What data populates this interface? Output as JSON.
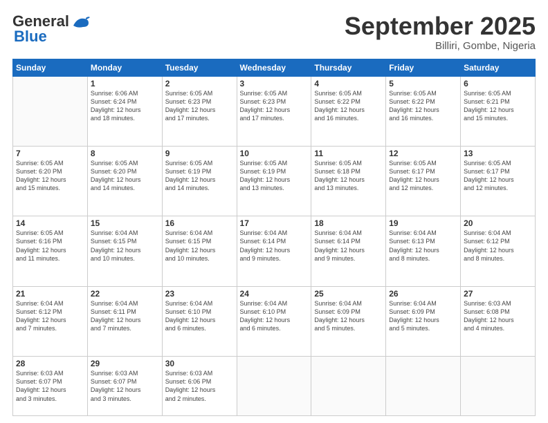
{
  "header": {
    "logo_line1": "General",
    "logo_line2": "Blue",
    "month": "September 2025",
    "location": "Billiri, Gombe, Nigeria"
  },
  "weekdays": [
    "Sunday",
    "Monday",
    "Tuesday",
    "Wednesday",
    "Thursday",
    "Friday",
    "Saturday"
  ],
  "weeks": [
    [
      {
        "day": "",
        "info": ""
      },
      {
        "day": "1",
        "info": "Sunrise: 6:06 AM\nSunset: 6:24 PM\nDaylight: 12 hours\nand 18 minutes."
      },
      {
        "day": "2",
        "info": "Sunrise: 6:05 AM\nSunset: 6:23 PM\nDaylight: 12 hours\nand 17 minutes."
      },
      {
        "day": "3",
        "info": "Sunrise: 6:05 AM\nSunset: 6:23 PM\nDaylight: 12 hours\nand 17 minutes."
      },
      {
        "day": "4",
        "info": "Sunrise: 6:05 AM\nSunset: 6:22 PM\nDaylight: 12 hours\nand 16 minutes."
      },
      {
        "day": "5",
        "info": "Sunrise: 6:05 AM\nSunset: 6:22 PM\nDaylight: 12 hours\nand 16 minutes."
      },
      {
        "day": "6",
        "info": "Sunrise: 6:05 AM\nSunset: 6:21 PM\nDaylight: 12 hours\nand 15 minutes."
      }
    ],
    [
      {
        "day": "7",
        "info": "Sunrise: 6:05 AM\nSunset: 6:20 PM\nDaylight: 12 hours\nand 15 minutes."
      },
      {
        "day": "8",
        "info": "Sunrise: 6:05 AM\nSunset: 6:20 PM\nDaylight: 12 hours\nand 14 minutes."
      },
      {
        "day": "9",
        "info": "Sunrise: 6:05 AM\nSunset: 6:19 PM\nDaylight: 12 hours\nand 14 minutes."
      },
      {
        "day": "10",
        "info": "Sunrise: 6:05 AM\nSunset: 6:19 PM\nDaylight: 12 hours\nand 13 minutes."
      },
      {
        "day": "11",
        "info": "Sunrise: 6:05 AM\nSunset: 6:18 PM\nDaylight: 12 hours\nand 13 minutes."
      },
      {
        "day": "12",
        "info": "Sunrise: 6:05 AM\nSunset: 6:17 PM\nDaylight: 12 hours\nand 12 minutes."
      },
      {
        "day": "13",
        "info": "Sunrise: 6:05 AM\nSunset: 6:17 PM\nDaylight: 12 hours\nand 12 minutes."
      }
    ],
    [
      {
        "day": "14",
        "info": "Sunrise: 6:05 AM\nSunset: 6:16 PM\nDaylight: 12 hours\nand 11 minutes."
      },
      {
        "day": "15",
        "info": "Sunrise: 6:04 AM\nSunset: 6:15 PM\nDaylight: 12 hours\nand 10 minutes."
      },
      {
        "day": "16",
        "info": "Sunrise: 6:04 AM\nSunset: 6:15 PM\nDaylight: 12 hours\nand 10 minutes."
      },
      {
        "day": "17",
        "info": "Sunrise: 6:04 AM\nSunset: 6:14 PM\nDaylight: 12 hours\nand 9 minutes."
      },
      {
        "day": "18",
        "info": "Sunrise: 6:04 AM\nSunset: 6:14 PM\nDaylight: 12 hours\nand 9 minutes."
      },
      {
        "day": "19",
        "info": "Sunrise: 6:04 AM\nSunset: 6:13 PM\nDaylight: 12 hours\nand 8 minutes."
      },
      {
        "day": "20",
        "info": "Sunrise: 6:04 AM\nSunset: 6:12 PM\nDaylight: 12 hours\nand 8 minutes."
      }
    ],
    [
      {
        "day": "21",
        "info": "Sunrise: 6:04 AM\nSunset: 6:12 PM\nDaylight: 12 hours\nand 7 minutes."
      },
      {
        "day": "22",
        "info": "Sunrise: 6:04 AM\nSunset: 6:11 PM\nDaylight: 12 hours\nand 7 minutes."
      },
      {
        "day": "23",
        "info": "Sunrise: 6:04 AM\nSunset: 6:10 PM\nDaylight: 12 hours\nand 6 minutes."
      },
      {
        "day": "24",
        "info": "Sunrise: 6:04 AM\nSunset: 6:10 PM\nDaylight: 12 hours\nand 6 minutes."
      },
      {
        "day": "25",
        "info": "Sunrise: 6:04 AM\nSunset: 6:09 PM\nDaylight: 12 hours\nand 5 minutes."
      },
      {
        "day": "26",
        "info": "Sunrise: 6:04 AM\nSunset: 6:09 PM\nDaylight: 12 hours\nand 5 minutes."
      },
      {
        "day": "27",
        "info": "Sunrise: 6:03 AM\nSunset: 6:08 PM\nDaylight: 12 hours\nand 4 minutes."
      }
    ],
    [
      {
        "day": "28",
        "info": "Sunrise: 6:03 AM\nSunset: 6:07 PM\nDaylight: 12 hours\nand 3 minutes."
      },
      {
        "day": "29",
        "info": "Sunrise: 6:03 AM\nSunset: 6:07 PM\nDaylight: 12 hours\nand 3 minutes."
      },
      {
        "day": "30",
        "info": "Sunrise: 6:03 AM\nSunset: 6:06 PM\nDaylight: 12 hours\nand 2 minutes."
      },
      {
        "day": "",
        "info": ""
      },
      {
        "day": "",
        "info": ""
      },
      {
        "day": "",
        "info": ""
      },
      {
        "day": "",
        "info": ""
      }
    ]
  ]
}
